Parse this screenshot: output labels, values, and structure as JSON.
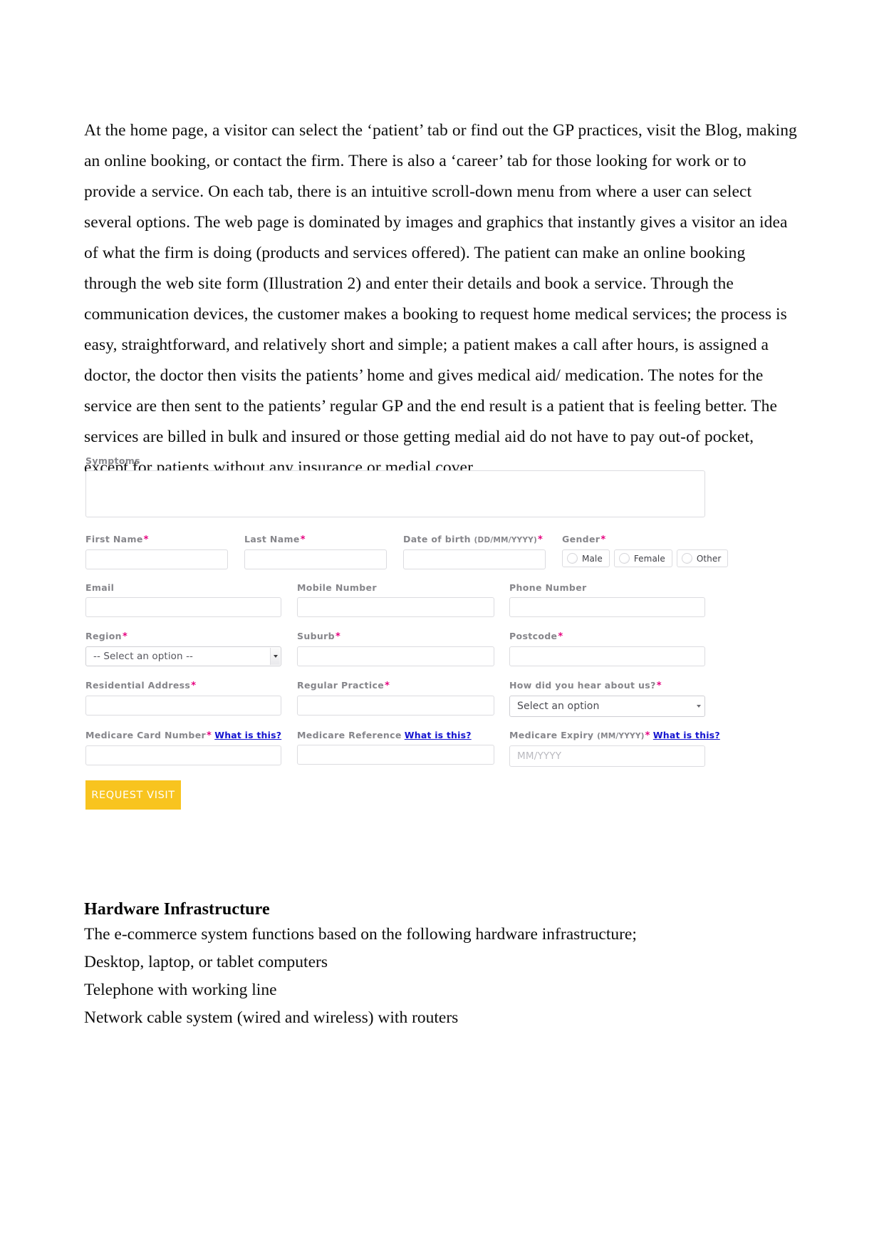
{
  "document": {
    "body_paragraph": "At the home page, a visitor can select the ‘patient’ tab or find out the GP practices, visit the Blog, making an online booking, or contact the firm. There is also a ‘career’ tab for those looking for work or to provide a service. On each tab, there is an intuitive scroll-down menu from where a user can select several options. The web page is dominated by images and graphics that instantly gives a visitor an idea of what the firm is doing (products and services offered). The patient can make an online booking through the web site form (Illustration 2) and enter their details and book a service. Through the communication devices, the customer makes a booking to request home medical services; the process is easy, straightforward, and relatively short and simple; a patient makes a call after hours, is assigned a doctor, the doctor then visits the patients’ home and gives medical aid/ medication. The notes for the service are then sent to the patients’ regular GP and the end result is a patient that is feeling better. The services are billed in bulk and insured or those getting medial aid do not have to pay out-of pocket, except for patients without any insurance or medial cover.",
    "heading": "Hardware Infrastructure",
    "tail_lines": [
      "The e-commerce system functions based on the following hardware infrastructure;",
      "Desktop, laptop, or tablet computers",
      "Telephone with working line",
      "Network cable system (wired and wireless) with routers"
    ]
  },
  "form": {
    "required_marker": "*",
    "what_is_this_label": "What is this?",
    "symptoms": {
      "label": "Symptoms",
      "value": "",
      "placeholder": ""
    },
    "first_name": {
      "label": "First Name",
      "required": true,
      "value": ""
    },
    "last_name": {
      "label": "Last Name",
      "required": true,
      "value": ""
    },
    "date_of_birth": {
      "label": "Date of birth",
      "format": "(DD/MM/YYYY)",
      "required": true,
      "value": ""
    },
    "gender": {
      "label": "Gender",
      "required": true,
      "options": [
        "Male",
        "Female",
        "Other"
      ],
      "selected": ""
    },
    "email": {
      "label": "Email",
      "required": false,
      "value": ""
    },
    "mobile_number": {
      "label": "Mobile Number",
      "required": false,
      "value": ""
    },
    "phone_number": {
      "label": "Phone Number",
      "required": false,
      "value": ""
    },
    "region": {
      "label": "Region",
      "required": true,
      "selected_option": "-- Select an option --"
    },
    "suburb": {
      "label": "Suburb",
      "required": true,
      "value": ""
    },
    "postcode": {
      "label": "Postcode",
      "required": true,
      "value": ""
    },
    "residential_address": {
      "label": "Residential Address",
      "required": true,
      "value": ""
    },
    "regular_practice": {
      "label": "Regular Practice",
      "required": true,
      "value": ""
    },
    "how_did_you_hear": {
      "label": "How did you hear about us?",
      "required": true,
      "selected_option": "Select an option"
    },
    "medicare_card_number": {
      "label": "Medicare Card Number",
      "required": true,
      "value": "",
      "help_link": "What is this?"
    },
    "medicare_reference": {
      "label": "Medicare Reference",
      "required": false,
      "value": "",
      "help_link": "What is this?"
    },
    "medicare_expiry": {
      "label": "Medicare Expiry",
      "format": "(MM/YYYY)",
      "required": true,
      "value": "",
      "placeholder": "MM/YYYY",
      "help_link": "What is this?"
    },
    "submit_button": {
      "label": "REQUEST VISIT"
    }
  },
  "colors": {
    "submit_background": "#f8c41f",
    "required_asterisk": "#e6007e",
    "help_link": "#1414d0",
    "label_text": "#86868b",
    "field_border": "#dcdce0"
  }
}
